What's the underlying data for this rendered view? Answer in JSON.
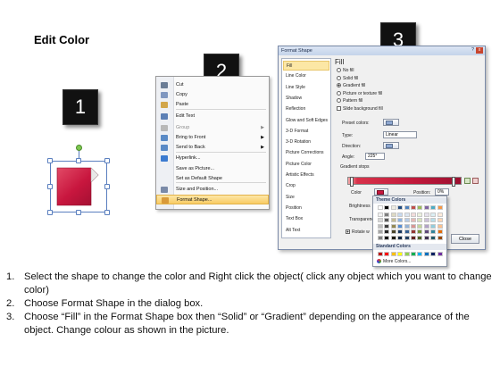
{
  "title": "Edit Color",
  "badges": [
    "1",
    "2",
    "3"
  ],
  "context_menu": {
    "items": [
      {
        "label": "Cut",
        "disabled": false,
        "submenu": false
      },
      {
        "label": "Copy",
        "disabled": false,
        "submenu": false
      },
      {
        "label": "Paste",
        "disabled": false,
        "submenu": false
      },
      {
        "label": "Edit Text",
        "disabled": false,
        "submenu": false
      },
      {
        "label": "Group",
        "disabled": true,
        "submenu": true
      },
      {
        "label": "Bring to Front",
        "disabled": false,
        "submenu": true
      },
      {
        "label": "Send to Back",
        "disabled": false,
        "submenu": true
      },
      {
        "label": "Hyperlink...",
        "disabled": false,
        "submenu": false
      },
      {
        "label": "Save as Picture...",
        "disabled": false,
        "submenu": false
      },
      {
        "label": "Set as Default Shape",
        "disabled": false,
        "submenu": false
      },
      {
        "label": "Size and Position...",
        "disabled": false,
        "submenu": false
      },
      {
        "label": "Format Shape...",
        "disabled": false,
        "submenu": false,
        "highlighted": true
      }
    ],
    "icon_names": [
      "scissors-icon",
      "copy-icon",
      "paste-icon",
      "edit-text-icon",
      "group-icon",
      "bring-front-icon",
      "send-back-icon",
      "hyperlink-icon",
      "",
      "",
      "size-icon",
      "format-shape-icon"
    ]
  },
  "dialog": {
    "title": "Format Shape",
    "help": "?",
    "close_x": "x",
    "categories": [
      "Fill",
      "Line Color",
      "Line Style",
      "Shadow",
      "Reflection",
      "Glow and Soft Edges",
      "3-D Format",
      "3-D Rotation",
      "Picture Corrections",
      "Picture Color",
      "Artistic Effects",
      "Crop",
      "Size",
      "Position",
      "Text Box",
      "Alt Text"
    ],
    "selected_category": "Fill",
    "panel_heading": "Fill",
    "fill_options": [
      {
        "label": "No fill",
        "kind": "radio",
        "checked": false
      },
      {
        "label": "Solid fill",
        "kind": "radio",
        "checked": false
      },
      {
        "label": "Gradient fill",
        "kind": "radio",
        "checked": true
      },
      {
        "label": "Picture or texture fill",
        "kind": "radio",
        "checked": false
      },
      {
        "label": "Pattern fill",
        "kind": "radio",
        "checked": false
      },
      {
        "label": "Slide background fill",
        "kind": "checkbox",
        "checked": false
      }
    ],
    "preset_colors_label": "Preset colors:",
    "type_label": "Type:",
    "type_value": "Linear",
    "direction_label": "Direction:",
    "angle_label": "Angle:",
    "angle_value": "225°",
    "gradient_stops_label": "Gradient stops",
    "color_label": "Color",
    "position_label": "Position:",
    "position_value": "0%",
    "brightness_label": "Brightness",
    "transparency_label": "Transparency",
    "rotate_label": "Rotate w",
    "close_button": "Close"
  },
  "color_popup": {
    "theme_heading": "Theme Colors",
    "standard_heading": "Standard Colors",
    "more_colors": "More Colors...",
    "theme_top_row": [
      "#ffffff",
      "#000000",
      "#eeece1",
      "#1f497d",
      "#4f81bd",
      "#c0504d",
      "#9bbb59",
      "#8064a2",
      "#4bacc6",
      "#f79646"
    ],
    "theme_shades": [
      [
        "#f2f2f2",
        "#7f7f7f",
        "#ddd9c3",
        "#c6d9f0",
        "#dbe5f1",
        "#f2dcdb",
        "#ebf1dd",
        "#e5e0ec",
        "#dbeef3",
        "#fdeada"
      ],
      [
        "#d8d8d8",
        "#595959",
        "#c4bd97",
        "#8db3e2",
        "#b8cce4",
        "#e5b9b7",
        "#d7e3bc",
        "#ccc1d9",
        "#b7dde8",
        "#fbd5b5"
      ],
      [
        "#bfbfbf",
        "#3f3f3f",
        "#938953",
        "#548dd4",
        "#95b3d7",
        "#d99694",
        "#c3d69b",
        "#b2a2c7",
        "#92cddc",
        "#fac08f"
      ],
      [
        "#a5a5a5",
        "#262626",
        "#494429",
        "#17365d",
        "#366092",
        "#953734",
        "#76923c",
        "#5f497a",
        "#31859b",
        "#e36c09"
      ],
      [
        "#7f7f7f",
        "#0c0c0c",
        "#1d1b10",
        "#0f243e",
        "#244061",
        "#632423",
        "#4f6128",
        "#3f3151",
        "#205867",
        "#974806"
      ]
    ],
    "standard": [
      "#c00000",
      "#ff0000",
      "#ffc000",
      "#ffff00",
      "#92d050",
      "#00b050",
      "#00b0f0",
      "#0070c0",
      "#002060",
      "#7030a0"
    ]
  },
  "steps": [
    {
      "n": "1.",
      "text": "Select the shape to change the color and Right click the object( click any object which you want to change color)"
    },
    {
      "n": "2.",
      "text": "Choose Format Shape in the dialog box."
    },
    {
      "n": "3.",
      "text": "Choose “Fill” in the Format Shape box then “Solid” or “Gradient” depending on the appearance of the object. Change colour as shown in the picture."
    }
  ],
  "colors": {
    "shape_red": "#c8163e",
    "menu_highlight": "#f9cc63"
  }
}
